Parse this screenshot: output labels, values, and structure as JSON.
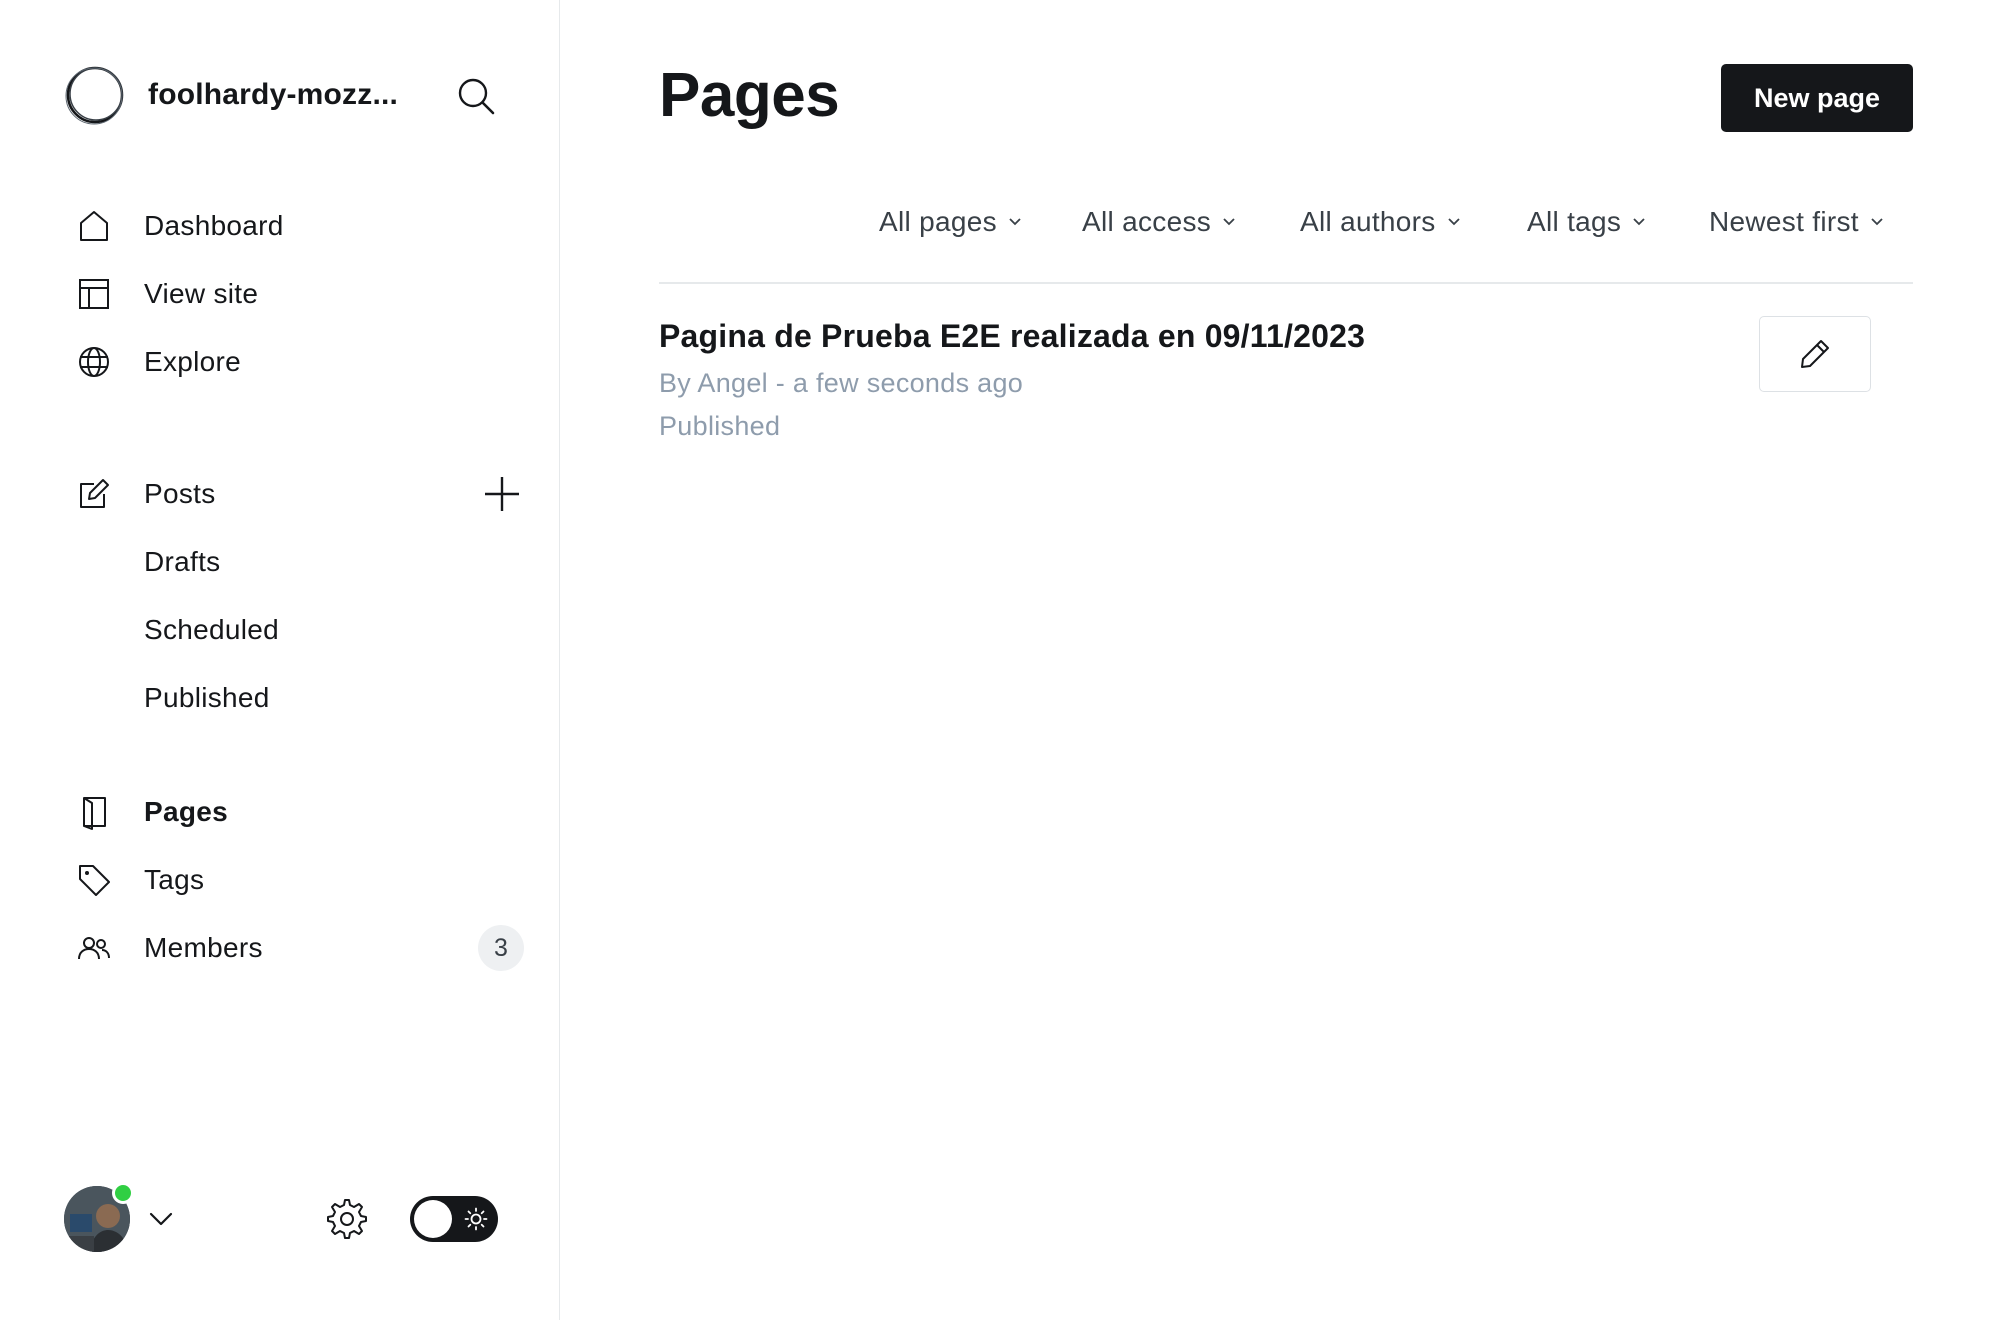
{
  "site": {
    "name": "foolhardy-mozz..."
  },
  "sidebar": {
    "primary": [
      {
        "label": "Dashboard",
        "icon": "home-icon"
      },
      {
        "label": "View site",
        "icon": "layout-icon"
      },
      {
        "label": "Explore",
        "icon": "globe-icon"
      }
    ],
    "posts": {
      "label": "Posts",
      "icon": "edit-icon",
      "sub": [
        "Drafts",
        "Scheduled",
        "Published"
      ]
    },
    "secondary": [
      {
        "label": "Pages",
        "icon": "page-icon",
        "active": true
      },
      {
        "label": "Tags",
        "icon": "tag-icon"
      },
      {
        "label": "Members",
        "icon": "members-icon",
        "count": "3"
      }
    ]
  },
  "main": {
    "title": "Pages",
    "new_button": "New page",
    "filters": [
      "All pages",
      "All access",
      "All authors",
      "All tags",
      "Newest first"
    ],
    "rows": [
      {
        "title": "Pagina de Prueba E2E realizada en 09/11/2023",
        "meta": "By Angel - a few seconds ago",
        "status": "Published"
      }
    ]
  },
  "colors": {
    "primary": "#15171a",
    "muted": "#8e9cac",
    "online": "#30cf43",
    "border": "#e6e9eb"
  }
}
